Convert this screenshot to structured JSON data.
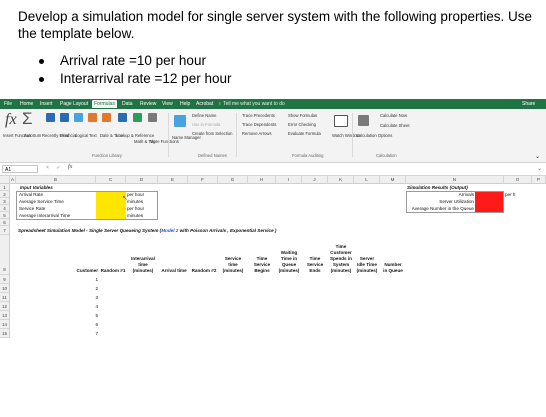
{
  "instructions": {
    "text": "Develop a simulation model for single server system with the following properties. Use the template below.",
    "bullets": [
      "Arrival rate =10 per hour",
      "Interarrival rate =12 per hour"
    ]
  },
  "excel": {
    "tabs": [
      "File",
      "Home",
      "Insert",
      "Page Layout",
      "Formulas",
      "Data",
      "Review",
      "View",
      "Help",
      "Acrobat"
    ],
    "active_tab": "Formulas",
    "tell_me": "Tell me what you want to do",
    "share": "Share",
    "ribbon": {
      "insert_function": "Insert Function",
      "autosum": "AutoSum",
      "recently_used": "Recently Used",
      "financial": "Financial",
      "logical": "Logical",
      "text": "Text",
      "date_time": "Date & Time",
      "lookup_reference": "Lookup & Reference",
      "math_trig": "Math & Trig",
      "more_functions": "More Functions",
      "group_function_library": "Function Library",
      "name_manager": "Name Manager",
      "define_name": "Define Name",
      "use_in_formula": "Use in Formula",
      "create_from_selection": "Create from Selection",
      "group_defined_names": "Defined Names",
      "trace_precedents": "Trace Precedents",
      "trace_dependents": "Trace Dependents",
      "remove_arrows": "Remove Arrows",
      "show_formulas": "Show Formulas",
      "error_checking": "Error Checking",
      "evaluate_formula": "Evaluate Formula",
      "watch_window": "Watch Window",
      "group_formula_auditing": "Formula Auditing",
      "calc_options": "Calculation Options",
      "calc_now": "Calculate Now",
      "calc_sheet": "Calculate Sheet",
      "group_calculation": "Calculation"
    },
    "name_box": "A1",
    "formula_buttons": "× ✓",
    "fx": "fx",
    "columns": [
      "A",
      "B",
      "C",
      "D",
      "E",
      "F",
      "G",
      "H",
      "I",
      "J",
      "K",
      "L",
      "M",
      "N",
      "O",
      "P"
    ],
    "rows": [
      "1",
      "2",
      "3",
      "4",
      "5",
      "6",
      "7",
      "8",
      "9",
      "10",
      "11",
      "12",
      "13",
      "14",
      "15"
    ],
    "input_title": "Input Variables",
    "inputs": [
      {
        "label": "Arrival Rate",
        "unit": "per hour"
      },
      {
        "label": "Average Service Time",
        "unit": "minutes"
      },
      {
        "label": "Service Rate",
        "unit": "per hour"
      },
      {
        "label": "Average Interarrival Time",
        "unit": "minutes"
      }
    ],
    "results_title": "Simulation Results (Output)",
    "results": [
      "Arrivals",
      "Server Utilization",
      "Average Number in the Queue"
    ],
    "results_unit": "per h",
    "sheet_title_pre": "Spreadsheet Simulation Model - Single Server Queueing System (",
    "sheet_title_link": "Model 2",
    "sheet_title_post": " with Poisson Arrivals , Exponential Service )",
    "table_headers": {
      "customer": "Customer",
      "random1": "Random #1",
      "interarrival": [
        "Interarrival",
        "time",
        "(minutes)"
      ],
      "arrival_time": "Arrival time",
      "random2": "Random #2",
      "service_time": [
        "Service",
        "time",
        "(minutes)"
      ],
      "time_service_begins": [
        "Time",
        "Service",
        "Begins"
      ],
      "waiting_time": [
        "Waiting",
        "Time in",
        "Queue",
        "(minutes)"
      ],
      "time_service_ends": [
        "Time",
        "Service",
        "Ends"
      ],
      "time_customer_spends": [
        "Time",
        "Customer",
        "Spends in",
        "System",
        "(minutes)"
      ],
      "server_idle": [
        "Server",
        "Idle Time",
        "(minutes)"
      ],
      "number_in_queue": [
        "Number",
        "in Queue"
      ]
    },
    "customers": [
      "1",
      "2",
      "3",
      "4",
      "5",
      "6",
      "7"
    ]
  }
}
